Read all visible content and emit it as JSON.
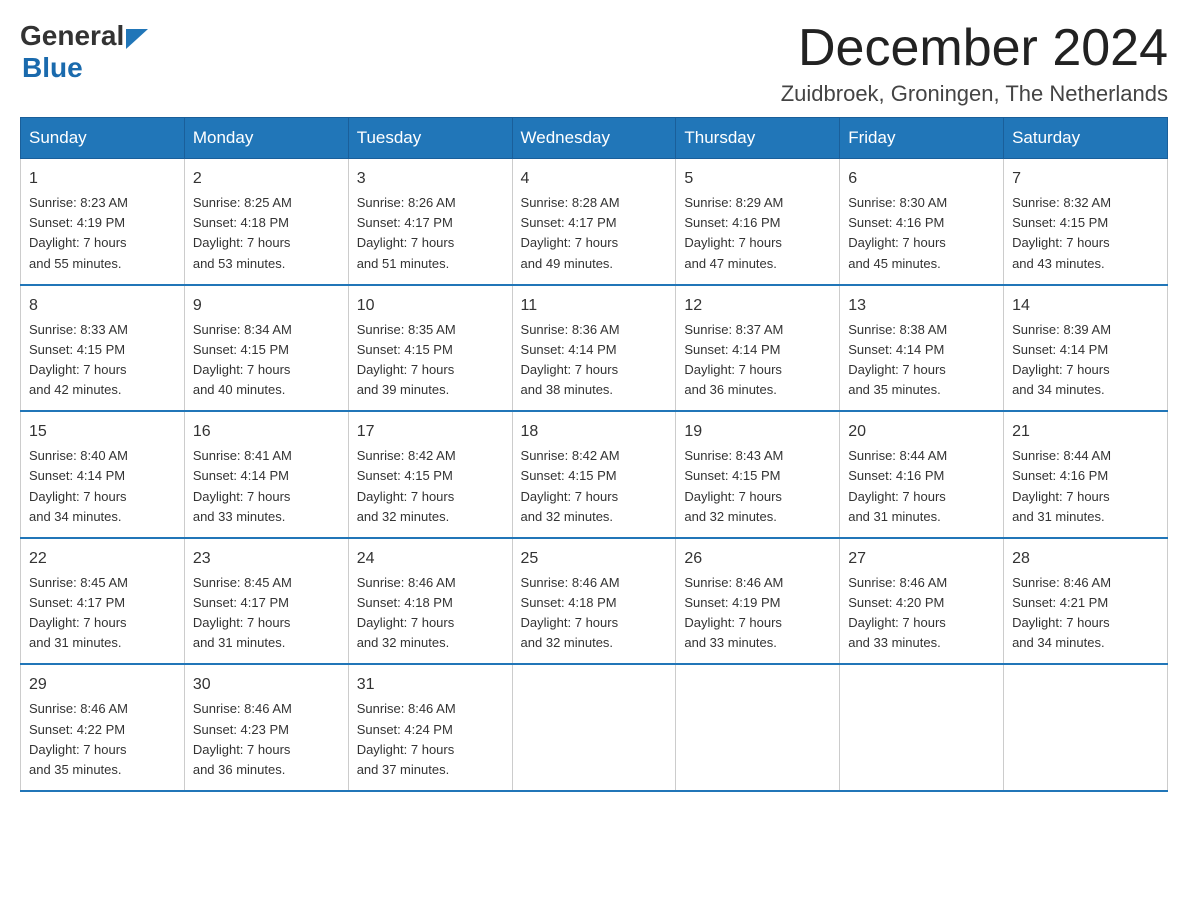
{
  "header": {
    "logo_general": "General",
    "logo_blue": "Blue",
    "title": "December 2024",
    "subtitle": "Zuidbroek, Groningen, The Netherlands"
  },
  "days_of_week": [
    "Sunday",
    "Monday",
    "Tuesday",
    "Wednesday",
    "Thursday",
    "Friday",
    "Saturday"
  ],
  "weeks": [
    [
      {
        "day": "1",
        "sunrise": "Sunrise: 8:23 AM",
        "sunset": "Sunset: 4:19 PM",
        "daylight": "Daylight: 7 hours",
        "daylight2": "and 55 minutes."
      },
      {
        "day": "2",
        "sunrise": "Sunrise: 8:25 AM",
        "sunset": "Sunset: 4:18 PM",
        "daylight": "Daylight: 7 hours",
        "daylight2": "and 53 minutes."
      },
      {
        "day": "3",
        "sunrise": "Sunrise: 8:26 AM",
        "sunset": "Sunset: 4:17 PM",
        "daylight": "Daylight: 7 hours",
        "daylight2": "and 51 minutes."
      },
      {
        "day": "4",
        "sunrise": "Sunrise: 8:28 AM",
        "sunset": "Sunset: 4:17 PM",
        "daylight": "Daylight: 7 hours",
        "daylight2": "and 49 minutes."
      },
      {
        "day": "5",
        "sunrise": "Sunrise: 8:29 AM",
        "sunset": "Sunset: 4:16 PM",
        "daylight": "Daylight: 7 hours",
        "daylight2": "and 47 minutes."
      },
      {
        "day": "6",
        "sunrise": "Sunrise: 8:30 AM",
        "sunset": "Sunset: 4:16 PM",
        "daylight": "Daylight: 7 hours",
        "daylight2": "and 45 minutes."
      },
      {
        "day": "7",
        "sunrise": "Sunrise: 8:32 AM",
        "sunset": "Sunset: 4:15 PM",
        "daylight": "Daylight: 7 hours",
        "daylight2": "and 43 minutes."
      }
    ],
    [
      {
        "day": "8",
        "sunrise": "Sunrise: 8:33 AM",
        "sunset": "Sunset: 4:15 PM",
        "daylight": "Daylight: 7 hours",
        "daylight2": "and 42 minutes."
      },
      {
        "day": "9",
        "sunrise": "Sunrise: 8:34 AM",
        "sunset": "Sunset: 4:15 PM",
        "daylight": "Daylight: 7 hours",
        "daylight2": "and 40 minutes."
      },
      {
        "day": "10",
        "sunrise": "Sunrise: 8:35 AM",
        "sunset": "Sunset: 4:15 PM",
        "daylight": "Daylight: 7 hours",
        "daylight2": "and 39 minutes."
      },
      {
        "day": "11",
        "sunrise": "Sunrise: 8:36 AM",
        "sunset": "Sunset: 4:14 PM",
        "daylight": "Daylight: 7 hours",
        "daylight2": "and 38 minutes."
      },
      {
        "day": "12",
        "sunrise": "Sunrise: 8:37 AM",
        "sunset": "Sunset: 4:14 PM",
        "daylight": "Daylight: 7 hours",
        "daylight2": "and 36 minutes."
      },
      {
        "day": "13",
        "sunrise": "Sunrise: 8:38 AM",
        "sunset": "Sunset: 4:14 PM",
        "daylight": "Daylight: 7 hours",
        "daylight2": "and 35 minutes."
      },
      {
        "day": "14",
        "sunrise": "Sunrise: 8:39 AM",
        "sunset": "Sunset: 4:14 PM",
        "daylight": "Daylight: 7 hours",
        "daylight2": "and 34 minutes."
      }
    ],
    [
      {
        "day": "15",
        "sunrise": "Sunrise: 8:40 AM",
        "sunset": "Sunset: 4:14 PM",
        "daylight": "Daylight: 7 hours",
        "daylight2": "and 34 minutes."
      },
      {
        "day": "16",
        "sunrise": "Sunrise: 8:41 AM",
        "sunset": "Sunset: 4:14 PM",
        "daylight": "Daylight: 7 hours",
        "daylight2": "and 33 minutes."
      },
      {
        "day": "17",
        "sunrise": "Sunrise: 8:42 AM",
        "sunset": "Sunset: 4:15 PM",
        "daylight": "Daylight: 7 hours",
        "daylight2": "and 32 minutes."
      },
      {
        "day": "18",
        "sunrise": "Sunrise: 8:42 AM",
        "sunset": "Sunset: 4:15 PM",
        "daylight": "Daylight: 7 hours",
        "daylight2": "and 32 minutes."
      },
      {
        "day": "19",
        "sunrise": "Sunrise: 8:43 AM",
        "sunset": "Sunset: 4:15 PM",
        "daylight": "Daylight: 7 hours",
        "daylight2": "and 32 minutes."
      },
      {
        "day": "20",
        "sunrise": "Sunrise: 8:44 AM",
        "sunset": "Sunset: 4:16 PM",
        "daylight": "Daylight: 7 hours",
        "daylight2": "and 31 minutes."
      },
      {
        "day": "21",
        "sunrise": "Sunrise: 8:44 AM",
        "sunset": "Sunset: 4:16 PM",
        "daylight": "Daylight: 7 hours",
        "daylight2": "and 31 minutes."
      }
    ],
    [
      {
        "day": "22",
        "sunrise": "Sunrise: 8:45 AM",
        "sunset": "Sunset: 4:17 PM",
        "daylight": "Daylight: 7 hours",
        "daylight2": "and 31 minutes."
      },
      {
        "day": "23",
        "sunrise": "Sunrise: 8:45 AM",
        "sunset": "Sunset: 4:17 PM",
        "daylight": "Daylight: 7 hours",
        "daylight2": "and 31 minutes."
      },
      {
        "day": "24",
        "sunrise": "Sunrise: 8:46 AM",
        "sunset": "Sunset: 4:18 PM",
        "daylight": "Daylight: 7 hours",
        "daylight2": "and 32 minutes."
      },
      {
        "day": "25",
        "sunrise": "Sunrise: 8:46 AM",
        "sunset": "Sunset: 4:18 PM",
        "daylight": "Daylight: 7 hours",
        "daylight2": "and 32 minutes."
      },
      {
        "day": "26",
        "sunrise": "Sunrise: 8:46 AM",
        "sunset": "Sunset: 4:19 PM",
        "daylight": "Daylight: 7 hours",
        "daylight2": "and 33 minutes."
      },
      {
        "day": "27",
        "sunrise": "Sunrise: 8:46 AM",
        "sunset": "Sunset: 4:20 PM",
        "daylight": "Daylight: 7 hours",
        "daylight2": "and 33 minutes."
      },
      {
        "day": "28",
        "sunrise": "Sunrise: 8:46 AM",
        "sunset": "Sunset: 4:21 PM",
        "daylight": "Daylight: 7 hours",
        "daylight2": "and 34 minutes."
      }
    ],
    [
      {
        "day": "29",
        "sunrise": "Sunrise: 8:46 AM",
        "sunset": "Sunset: 4:22 PM",
        "daylight": "Daylight: 7 hours",
        "daylight2": "and 35 minutes."
      },
      {
        "day": "30",
        "sunrise": "Sunrise: 8:46 AM",
        "sunset": "Sunset: 4:23 PM",
        "daylight": "Daylight: 7 hours",
        "daylight2": "and 36 minutes."
      },
      {
        "day": "31",
        "sunrise": "Sunrise: 8:46 AM",
        "sunset": "Sunset: 4:24 PM",
        "daylight": "Daylight: 7 hours",
        "daylight2": "and 37 minutes."
      },
      null,
      null,
      null,
      null
    ]
  ]
}
